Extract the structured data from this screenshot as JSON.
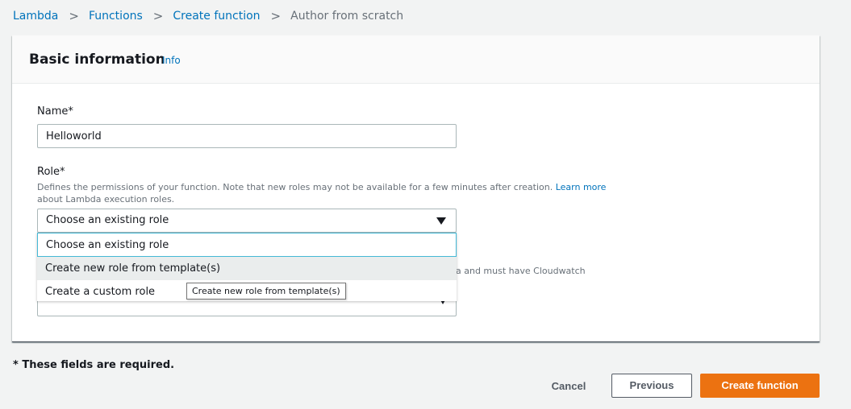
{
  "breadcrumb": {
    "items": [
      "Lambda",
      "Functions",
      "Create function"
    ],
    "current": "Author from scratch",
    "separator": ">"
  },
  "panel": {
    "title": "Basic information",
    "info_link": "Info"
  },
  "name_field": {
    "label": "Name*",
    "value": "Helloworld"
  },
  "role_field": {
    "label": "Role*",
    "description": "Defines the permissions of your function. Note that new roles may not be available for a few minutes after creation.",
    "learn_more": "Learn more",
    "description_tail": "about Lambda execution roles.",
    "selected": "Choose an existing role",
    "options": [
      "Choose an existing role",
      "Create new role from template(s)",
      "Create a custom role"
    ],
    "hovered_option": "Create new role from template(s)"
  },
  "partially_hidden_text": "a and must have Cloudwatch",
  "tooltip": "Create new role from template(s)",
  "footer": {
    "required_note": "* These fields are required.",
    "cancel": "Cancel",
    "previous": "Previous",
    "create": "Create function"
  },
  "colors": {
    "link": "#0073bb",
    "primary_button": "#ec7211",
    "background": "#f2f3f3",
    "focus_border": "#44b9d6"
  },
  "icons": {
    "breadcrumb_separator": "chevron-right-icon",
    "dropdown": "caret-down-icon"
  }
}
